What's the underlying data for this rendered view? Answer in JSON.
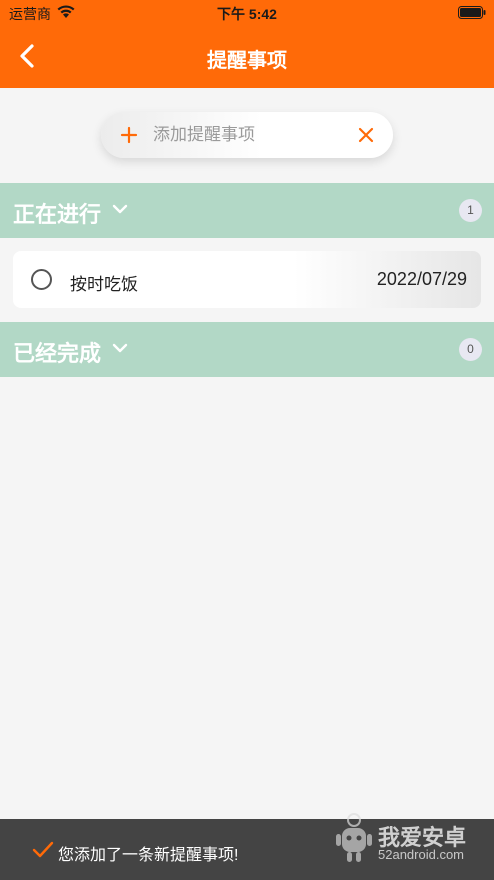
{
  "status_bar": {
    "carrier": "运营商",
    "time": "下午 5:42"
  },
  "header": {
    "title": "提醒事项"
  },
  "add_bar": {
    "placeholder": "添加提醒事项"
  },
  "sections": {
    "in_progress": {
      "title": "正在进行",
      "count": "1",
      "items": [
        {
          "text": "按时吃饭",
          "date": "2022/07/29"
        }
      ]
    },
    "completed": {
      "title": "已经完成",
      "count": "0"
    }
  },
  "toast": {
    "message": "您添加了一条新提醒事项!"
  },
  "watermark": {
    "name": "我爱安卓",
    "url": "52android.com"
  },
  "colors": {
    "header": "#ff6a08",
    "accent": "#ff6a08",
    "section_header": "#b2d8c6",
    "toast_bg": "#444444"
  }
}
